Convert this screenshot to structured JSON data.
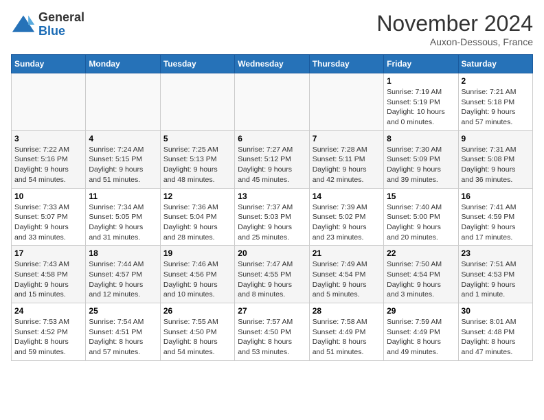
{
  "header": {
    "logo_general": "General",
    "logo_blue": "Blue",
    "month": "November 2024",
    "location": "Auxon-Dessous, France"
  },
  "weekdays": [
    "Sunday",
    "Monday",
    "Tuesday",
    "Wednesday",
    "Thursday",
    "Friday",
    "Saturday"
  ],
  "weeks": [
    [
      {
        "day": "",
        "info": ""
      },
      {
        "day": "",
        "info": ""
      },
      {
        "day": "",
        "info": ""
      },
      {
        "day": "",
        "info": ""
      },
      {
        "day": "",
        "info": ""
      },
      {
        "day": "1",
        "info": "Sunrise: 7:19 AM\nSunset: 5:19 PM\nDaylight: 10 hours\nand 0 minutes."
      },
      {
        "day": "2",
        "info": "Sunrise: 7:21 AM\nSunset: 5:18 PM\nDaylight: 9 hours\nand 57 minutes."
      }
    ],
    [
      {
        "day": "3",
        "info": "Sunrise: 7:22 AM\nSunset: 5:16 PM\nDaylight: 9 hours\nand 54 minutes."
      },
      {
        "day": "4",
        "info": "Sunrise: 7:24 AM\nSunset: 5:15 PM\nDaylight: 9 hours\nand 51 minutes."
      },
      {
        "day": "5",
        "info": "Sunrise: 7:25 AM\nSunset: 5:13 PM\nDaylight: 9 hours\nand 48 minutes."
      },
      {
        "day": "6",
        "info": "Sunrise: 7:27 AM\nSunset: 5:12 PM\nDaylight: 9 hours\nand 45 minutes."
      },
      {
        "day": "7",
        "info": "Sunrise: 7:28 AM\nSunset: 5:11 PM\nDaylight: 9 hours\nand 42 minutes."
      },
      {
        "day": "8",
        "info": "Sunrise: 7:30 AM\nSunset: 5:09 PM\nDaylight: 9 hours\nand 39 minutes."
      },
      {
        "day": "9",
        "info": "Sunrise: 7:31 AM\nSunset: 5:08 PM\nDaylight: 9 hours\nand 36 minutes."
      }
    ],
    [
      {
        "day": "10",
        "info": "Sunrise: 7:33 AM\nSunset: 5:07 PM\nDaylight: 9 hours\nand 33 minutes."
      },
      {
        "day": "11",
        "info": "Sunrise: 7:34 AM\nSunset: 5:05 PM\nDaylight: 9 hours\nand 31 minutes."
      },
      {
        "day": "12",
        "info": "Sunrise: 7:36 AM\nSunset: 5:04 PM\nDaylight: 9 hours\nand 28 minutes."
      },
      {
        "day": "13",
        "info": "Sunrise: 7:37 AM\nSunset: 5:03 PM\nDaylight: 9 hours\nand 25 minutes."
      },
      {
        "day": "14",
        "info": "Sunrise: 7:39 AM\nSunset: 5:02 PM\nDaylight: 9 hours\nand 23 minutes."
      },
      {
        "day": "15",
        "info": "Sunrise: 7:40 AM\nSunset: 5:00 PM\nDaylight: 9 hours\nand 20 minutes."
      },
      {
        "day": "16",
        "info": "Sunrise: 7:41 AM\nSunset: 4:59 PM\nDaylight: 9 hours\nand 17 minutes."
      }
    ],
    [
      {
        "day": "17",
        "info": "Sunrise: 7:43 AM\nSunset: 4:58 PM\nDaylight: 9 hours\nand 15 minutes."
      },
      {
        "day": "18",
        "info": "Sunrise: 7:44 AM\nSunset: 4:57 PM\nDaylight: 9 hours\nand 12 minutes."
      },
      {
        "day": "19",
        "info": "Sunrise: 7:46 AM\nSunset: 4:56 PM\nDaylight: 9 hours\nand 10 minutes."
      },
      {
        "day": "20",
        "info": "Sunrise: 7:47 AM\nSunset: 4:55 PM\nDaylight: 9 hours\nand 8 minutes."
      },
      {
        "day": "21",
        "info": "Sunrise: 7:49 AM\nSunset: 4:54 PM\nDaylight: 9 hours\nand 5 minutes."
      },
      {
        "day": "22",
        "info": "Sunrise: 7:50 AM\nSunset: 4:54 PM\nDaylight: 9 hours\nand 3 minutes."
      },
      {
        "day": "23",
        "info": "Sunrise: 7:51 AM\nSunset: 4:53 PM\nDaylight: 9 hours\nand 1 minute."
      }
    ],
    [
      {
        "day": "24",
        "info": "Sunrise: 7:53 AM\nSunset: 4:52 PM\nDaylight: 8 hours\nand 59 minutes."
      },
      {
        "day": "25",
        "info": "Sunrise: 7:54 AM\nSunset: 4:51 PM\nDaylight: 8 hours\nand 57 minutes."
      },
      {
        "day": "26",
        "info": "Sunrise: 7:55 AM\nSunset: 4:50 PM\nDaylight: 8 hours\nand 54 minutes."
      },
      {
        "day": "27",
        "info": "Sunrise: 7:57 AM\nSunset: 4:50 PM\nDaylight: 8 hours\nand 53 minutes."
      },
      {
        "day": "28",
        "info": "Sunrise: 7:58 AM\nSunset: 4:49 PM\nDaylight: 8 hours\nand 51 minutes."
      },
      {
        "day": "29",
        "info": "Sunrise: 7:59 AM\nSunset: 4:49 PM\nDaylight: 8 hours\nand 49 minutes."
      },
      {
        "day": "30",
        "info": "Sunrise: 8:01 AM\nSunset: 4:48 PM\nDaylight: 8 hours\nand 47 minutes."
      }
    ]
  ]
}
